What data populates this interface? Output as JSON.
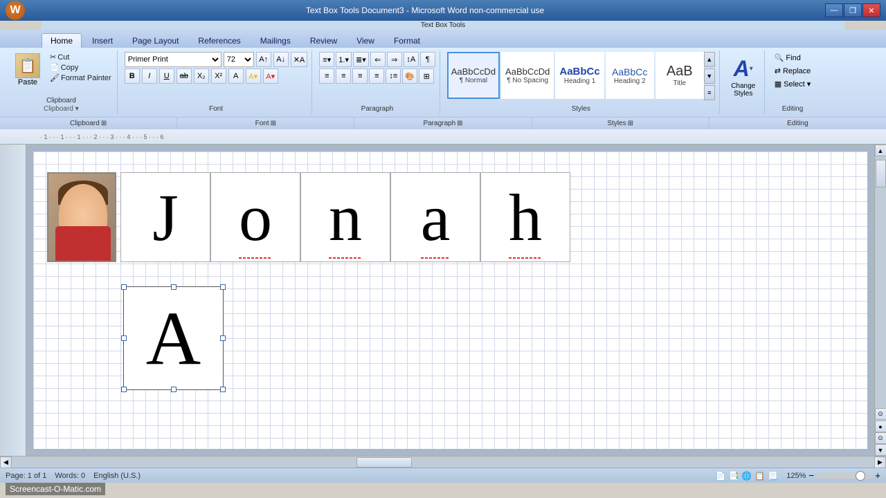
{
  "window": {
    "title": "Text Box Tools    Document3 - Microsoft Word non-commercial use",
    "minimize": "—",
    "restore": "❐",
    "close": "✕"
  },
  "ribbon": {
    "contextual_label": "Text Box Tools",
    "tabs": [
      "Home",
      "Insert",
      "Page Layout",
      "References",
      "Mailings",
      "Review",
      "View",
      "Format"
    ],
    "active_tab": "Home"
  },
  "clipboard": {
    "paste_label": "Paste",
    "cut_label": "Cut",
    "copy_label": "Copy",
    "format_painter_label": "Format Painter",
    "group_label": "Clipboard"
  },
  "font": {
    "family": "Primer Print",
    "size": "72",
    "group_label": "Font"
  },
  "paragraph": {
    "group_label": "Paragraph"
  },
  "styles": {
    "group_label": "Styles",
    "items": [
      {
        "id": "normal",
        "preview": "AaBbCcDd",
        "label": "¶ Normal",
        "active": true
      },
      {
        "id": "no-spacing",
        "preview": "AaBbCcDd",
        "label": "¶ No Spacing"
      },
      {
        "id": "heading1",
        "preview": "AaBbCc",
        "label": "Heading 1"
      },
      {
        "id": "heading2",
        "preview": "AaBbCc",
        "label": "Heading 2"
      },
      {
        "id": "title",
        "preview": "AaB",
        "label": "Title"
      }
    ]
  },
  "change_styles": {
    "label": "Change\nStyles"
  },
  "editing": {
    "group_label": "Editing",
    "find_label": "Find",
    "replace_label": "Replace",
    "select_label": "Select"
  },
  "document": {
    "photo_alt": "child photo",
    "letters": [
      "J",
      "o",
      "n",
      "a",
      "h"
    ],
    "letter_A": "A"
  },
  "statusbar": {
    "page_info": "Page: 1 of 1",
    "words": "Words: 0",
    "language": "English (U.S.)",
    "zoom": "125%",
    "view_icons": [
      "📄",
      "📑",
      "📋",
      "📊"
    ]
  },
  "watermark": {
    "text": "Screencast-O-Matic.com"
  }
}
